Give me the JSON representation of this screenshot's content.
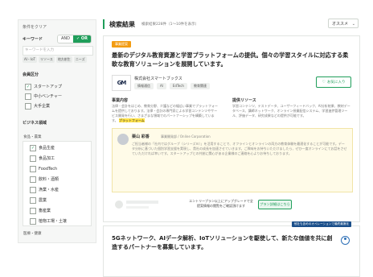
{
  "sidebar": {
    "title": "条件をクリア",
    "keyword_label": "キーワード",
    "logic_and": "AND",
    "logic_or": "✓ OR",
    "keyword_placeholder": "キーワードを入力",
    "keyword_tags": [
      "AI・IoT",
      "リソース",
      "地方創生",
      "ニーズ"
    ],
    "company_section": "会員区分",
    "company_items": [
      {
        "label": "スタートアップ",
        "checked": true
      },
      {
        "label": "中小ベンチャー",
        "checked": false
      },
      {
        "label": "大手企業",
        "checked": false
      }
    ],
    "business_section": "ビジネス領域",
    "sub_label": "食品・農業",
    "sub_items": [
      {
        "label": "食品生産",
        "checked": true
      },
      {
        "label": "食品加工",
        "checked": false
      },
      {
        "label": "FoodTech",
        "checked": false
      },
      {
        "label": "飲料・酒類",
        "checked": false
      },
      {
        "label": "漁業・水産",
        "checked": false
      },
      {
        "label": "農業",
        "checked": false
      },
      {
        "label": "畜産業",
        "checked": false
      },
      {
        "label": "植物工場・土壌",
        "checked": false
      }
    ],
    "bottom_label": "医療・健康"
  },
  "results": {
    "title": "検索結果",
    "meta": "検索結果228件（1～10件を表示）",
    "sort_label": "オススメ",
    "sort_icon": "chevron-down-icon"
  },
  "card1": {
    "badge": "事業提案",
    "title": "最新のデジタル教育資源と学習プラットフォームの提供。個々の学習スタイルに対応する柔軟な教育ソリューションを展開しています。",
    "logo_text": "GM",
    "company": "株式会社スマートブックス",
    "chips": [
      "情報通信",
      "AI",
      "EdTech",
      "教育関連"
    ],
    "fav_label": "お気に入り",
    "fav_icon": "heart-icon",
    "col1_header": "事業内容",
    "col1_text_a": "法律・会計をはじめ、教育分野、介護などの幅広い事業でプラットフォームを提供しております。法律・会計の専門家による学習コンテンツやサービス開発を行い、さまざまな領域でのパートナーシップを構築しています。",
    "col1_highlight": "プラットフォーム",
    "col2_header": "提供リソース",
    "col2_text": "学習コンテンツ、テストデータ、ユーザーフィードバック、AI分析結果、教材データベース、講師ネットワーク、オンライン授業配信システム、学習進捗管理ツール、評価データ、研究成果などの提供が可能です。",
    "msg_name": "栗山 彩香",
    "msg_role": "事業開発部 / Online Corporation",
    "msg_text": "ご担当者様の「社内ではグループ（シリーズＢ）」を活用することで、オフラインとオンラインの両方の教育体験を最適化することが可能です。データ分析に基づいた個別学習支援を実現し、貴社の成長を加速させていきます。ご興味をお持ちいただけましたら、ぜひ一度オンラインにてお話をさせていただければ幸いです。スタートアップとの共創に関心がある企業様のご連絡を心よりお待ちしております。",
    "upgrade_text": "エントリープラン以上にアップグレードで全提案情報の閲覧をご確認頂けます",
    "upgrade_button": "プラン詳細はこちら"
  },
  "card2": {
    "tooltip": "他社も含めのオペレーションで最終最適化",
    "title": "5Gネットワーク、AIデータ解析、IoTソリューションを駆使して、新たな価値を共に創造するパートナーを募集しています。",
    "icon": "accessibility-icon"
  }
}
